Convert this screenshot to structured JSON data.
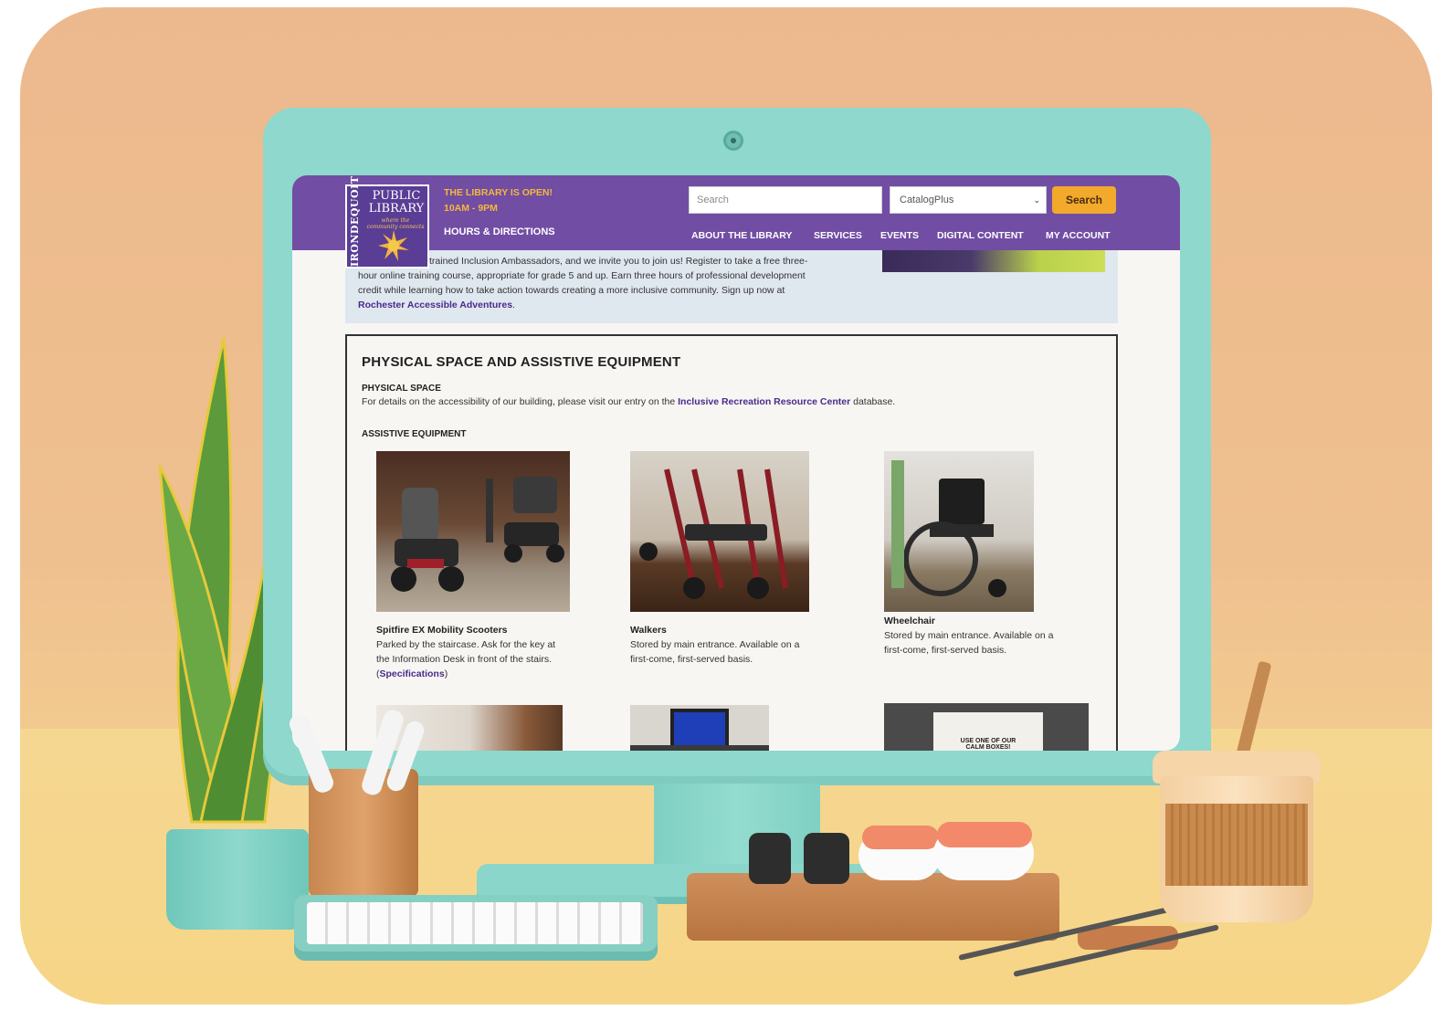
{
  "site": {
    "logo": {
      "vertical_text": "IRONDEQUOIT",
      "line1": "PUBLIC",
      "line2": "LIBRARY",
      "tagline": "where the community connects"
    },
    "status": {
      "open_text": "THE LIBRARY IS OPEN!",
      "hours": "10AM - 9PM",
      "hours_link": "HOURS & DIRECTIONS"
    },
    "search": {
      "placeholder": "Search",
      "catalog_selected": "CatalogPlus",
      "button_label": "Search"
    },
    "nav": [
      "ABOUT THE LIBRARY",
      "SERVICES",
      "EVENTS",
      "DIGITAL CONTENT",
      "MY ACCOUNT"
    ]
  },
  "intro": {
    "line1": "trained Inclusion Ambassadors, and we invite you to join us! Register to take a free three-",
    "line2": "hour online training course, appropriate for grade 5 and up. Earn three hours of professional development",
    "line3": "credit while learning how to take action towards creating a more inclusive community. Sign up now at",
    "link": "Rochester Accessible Adventures",
    "link_suffix": "."
  },
  "content": {
    "title": "PHYSICAL SPACE AND ASSISTIVE EQUIPMENT",
    "physical_heading": "PHYSICAL SPACE",
    "physical_text_before": "For details on the accessibility of our building, please visit our entry on the ",
    "physical_link": "Inclusive Recreation Resource Center",
    "physical_text_after": " database.",
    "equipment_heading": "ASSISTIVE EQUIPMENT",
    "items": [
      {
        "title": "Spitfire EX Mobility Scooters",
        "line1": "Parked by the staircase. Ask for the key at",
        "line2": "the Information Desk in front of the stairs.",
        "open_paren": "(",
        "link": "Specifications",
        "close_paren": ")"
      },
      {
        "title": "Walkers",
        "line1": "Stored by main entrance. Available on a",
        "line2": "first-come, first-served basis."
      },
      {
        "title": "Wheelchair",
        "line1": "Stored by main entrance. Available on a",
        "line2": "first-come, first-served basis."
      }
    ],
    "sign_text": {
      "line1": "USE ONE OF OUR",
      "line2": "CALM BOXES!"
    }
  },
  "colors": {
    "header_purple": "#6b46a0",
    "accent_orange": "#f2a92c",
    "link_purple": "#4a2b8c",
    "monitor_teal": "#8ed8cd",
    "background_peach": "#ecb98e"
  }
}
